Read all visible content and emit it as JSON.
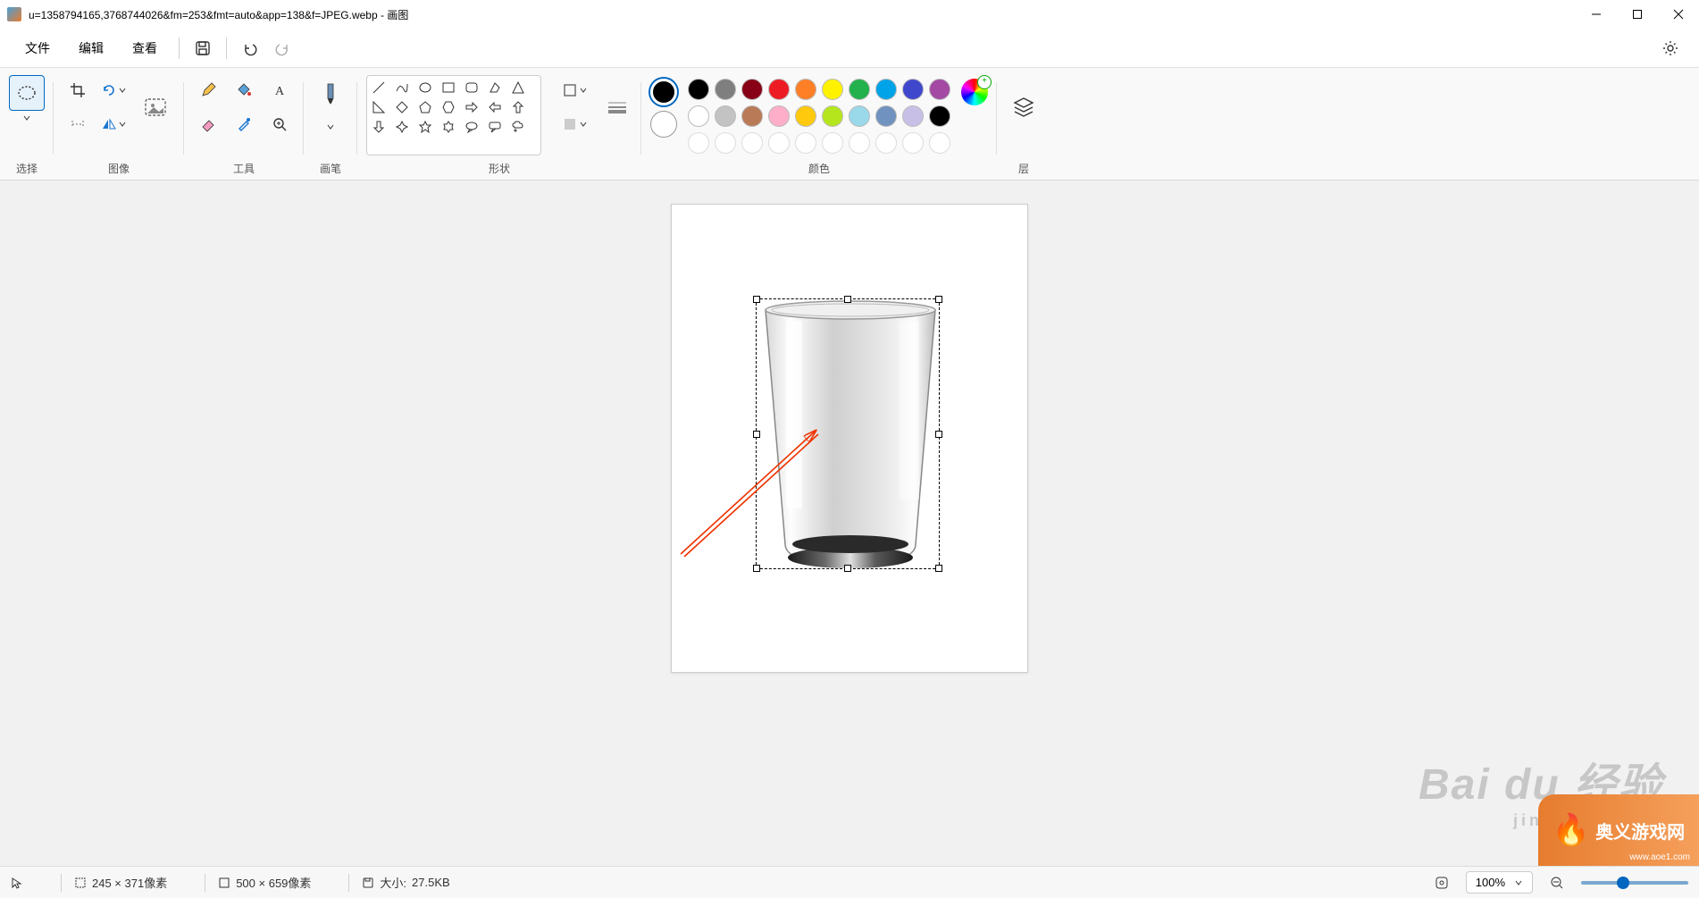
{
  "title_bar": {
    "filename": "u=1358794165,3768744026&fm=253&fmt=auto&app=138&f=JPEG.webp - 画图"
  },
  "menu": {
    "file": "文件",
    "edit": "编辑",
    "view": "查看"
  },
  "ribbon": {
    "select_label": "选择",
    "image_label": "图像",
    "tools_label": "工具",
    "brushes_label": "画笔",
    "shapes_label": "形状",
    "colors_label": "颜色",
    "layers_label": "层"
  },
  "palette": {
    "row1": [
      "#000000",
      "#7f7f7f",
      "#880015",
      "#ed1c24",
      "#ff7f27",
      "#fff200",
      "#22b14c",
      "#00a2e8",
      "#3f48cc",
      "#a349a4"
    ],
    "row2": [
      "#ffffff",
      "#c3c3c3",
      "#b97a57",
      "#ffaec9",
      "#ffc90e",
      "#b5e61d",
      "#99d9ea",
      "#7092be",
      "#c8bfe7",
      "#000000"
    ]
  },
  "status": {
    "selection_size": "245 × 371像素",
    "canvas_size": "500 × 659像素",
    "file_size_label": "大小: ",
    "file_size_value": "27.5KB",
    "zoom_value": "100%"
  },
  "watermark": {
    "main": "Bai du 经验",
    "sub": "jingyan.baidu",
    "corner_brand": "奥义游戏网",
    "corner_url": "www.aoe1.com"
  }
}
